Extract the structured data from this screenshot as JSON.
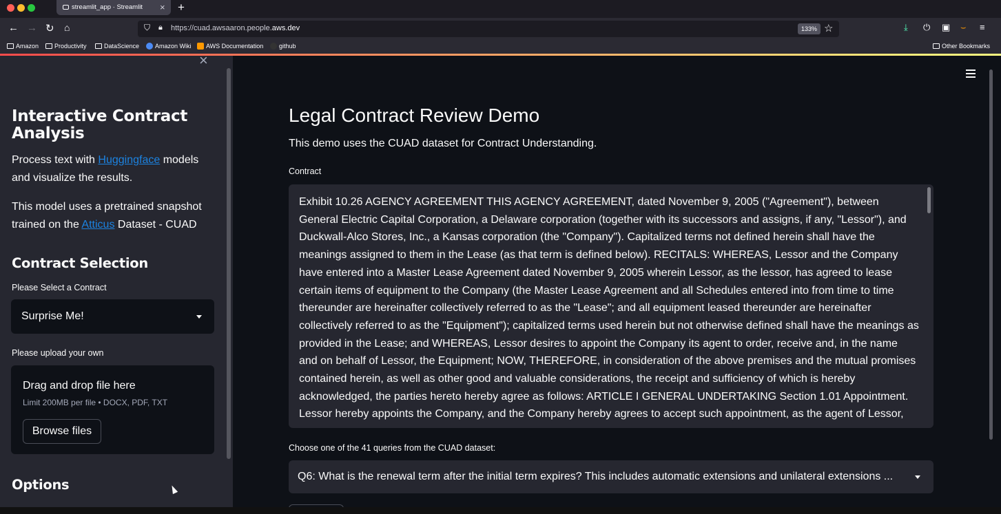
{
  "browser": {
    "tab_title": "streamlit_app · Streamlit",
    "url_prefix": "https://cuad.awsaaron.people.",
    "url_domain": "aws.dev",
    "zoom": "133%",
    "bookmarks": [
      "Amazon",
      "Productivity",
      "DataScience",
      "Amazon Wiki",
      "AWS Documentation",
      "github"
    ],
    "other_bookmarks": "Other Bookmarks"
  },
  "sidebar": {
    "title": "Interactive Contract Analysis",
    "intro_text": "Process text with",
    "intro_link": "Huggingface",
    "intro_rest": "models and visualize the results.",
    "model_text": "This model uses a pretrained snapshot trained on the",
    "model_link": "Atticus",
    "model_rest": "Dataset - CUAD",
    "contract_selection": "Contract Selection",
    "select_label": "Please Select a Contract",
    "select_value": "Surprise Me!",
    "upload_label": "Please upload your own",
    "upload_title": "Drag and drop file here",
    "upload_limits": "Limit 200MB per file • DOCX, PDF, TXT",
    "browse_label": "Browse files",
    "options_heading": "Options"
  },
  "main": {
    "title": "Legal Contract Review Demo",
    "subtitle": "This demo uses the CUAD dataset for Contract Understanding.",
    "contract_label": "Contract",
    "contract_text": "Exhibit 10.26 AGENCY AGREEMENT THIS AGENCY AGREEMENT, dated November 9, 2005 (\"Agreement\"), between General Electric Capital Corporation, a Delaware corporation (together with its successors and assigns, if any, \"Lessor\"), and Duckwall-Alco Stores, Inc., a Kansas corporation (the \"Company\"). Capitalized terms not defined herein shall have the meanings assigned to them in the Lease (as that term is defined below). RECITALS: WHEREAS, Lessor and the Company have entered into a Master Lease Agreement dated November 9, 2005 wherein Lessor, as the lessor, has agreed to lease certain items of equipment to the Company (the Master Lease Agreement and all Schedules entered into from time to time thereunder are hereinafter collectively referred to as the \"Lease\"; and all equipment leased thereunder are hereinafter collectively referred to as the \"Equipment\"); capitalized terms used herein but not otherwise defined shall have the meanings as provided in the Lease; and WHEREAS, Lessor desires to appoint the Company its agent to order, receive and, in the name and on behalf of Lessor, the Equipment; NOW, THEREFORE, in consideration of the above premises and the mutual promises contained herein, as well as other good and valuable considerations, the receipt and sufficiency of which is hereby acknowledged, the parties hereto hereby agree as follows: ARTICLE I GENERAL UNDERTAKING Section 1.01 Appointment. Lessor hereby appoints the Company, and the Company hereby agrees to accept such appointment, as the agent of Lessor,",
    "query_label": "Choose one of the 41 queries from the CUAD dataset:",
    "query_value": "Q6: What is the renewal term after the initial term expires? This includes automatic extensions and unilateral extensions ..."
  },
  "colors": {
    "link": "#1c83e1",
    "background": "#0e1117",
    "sidebar": "#262730",
    "accent_gradient_start": "#ff4b4b"
  }
}
